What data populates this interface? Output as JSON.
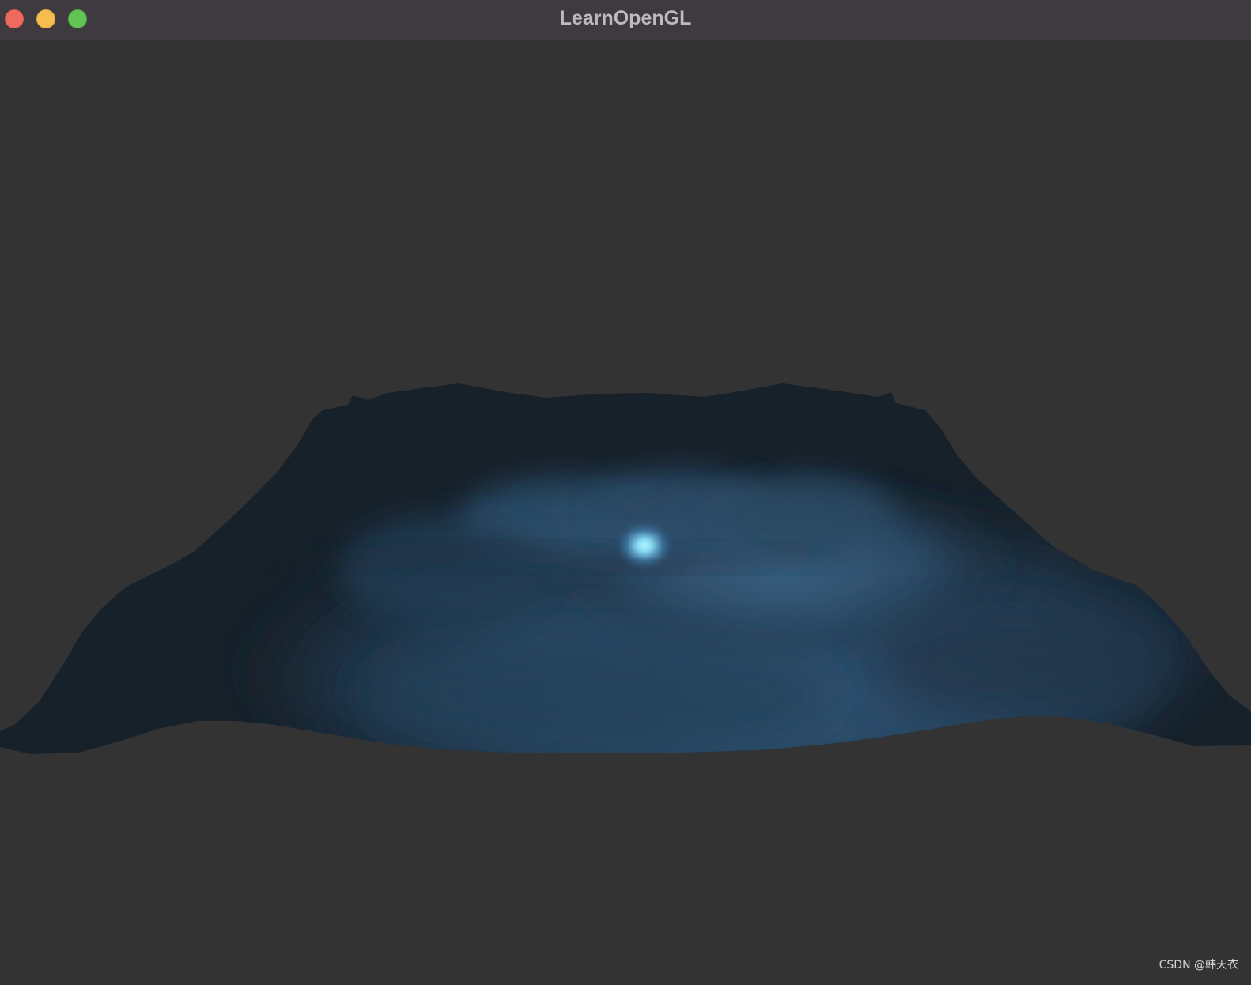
{
  "window": {
    "title": "LearnOpenGL"
  },
  "watermark": "CSDN @韩天衣",
  "colors": {
    "window_background": "#333333",
    "titlebar": "#3e3a40",
    "terrain_dark": "#17212a",
    "terrain_lit": "#33587a",
    "light_glow": "#7fd4f0",
    "close": "#ee6a5f",
    "minimize": "#f5bd4f",
    "zoom": "#61c454"
  }
}
